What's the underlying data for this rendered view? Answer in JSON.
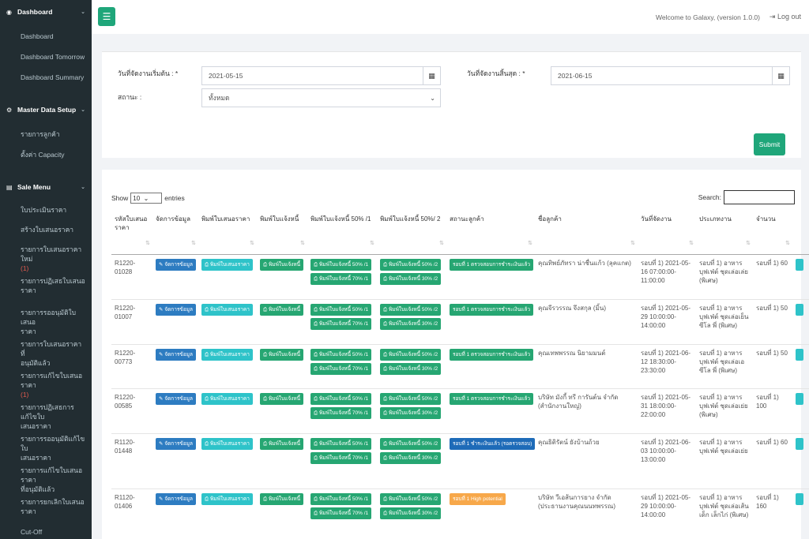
{
  "sidebar": {
    "sections": [
      {
        "title": "Dashboard",
        "icon": "gauge-icon",
        "items": [
          "Dashboard",
          "Dashboard Tomorrow",
          "Dashboard Summary"
        ]
      },
      {
        "title": "Master Data Setup",
        "icon": "gear-icon",
        "items": [
          "รายการลูกค้า",
          "ตั้งค่า Capacity"
        ]
      },
      {
        "title": "Sale Menu",
        "icon": "document-icon",
        "items": [
          "ใบประเมินราคา",
          "สร้างใบเสนอราคา",
          "รายการใบเสนอราคาใหม่",
          "(1)",
          "รายการปฏิเสธใบเสนอ",
          "ราคา",
          "รายการรออนุมัติใบเสนอ",
          "ราคา",
          "รายการใบเสนอราคาที่",
          "อนุมัติแล้ว",
          "รายการแก้ไขใบเสนอราคา",
          "(1)",
          "รายการปฏิเสธการแก้ไขใบ",
          "เสนอราคา",
          "รายการรออนุมัติแก้ไขใบ",
          "เสนอราคา",
          "รายการแก้ไขใบเสนอราคา",
          "ที่อนุมัติแล้ว",
          "รายการยกเลิกใบเสนอ",
          "ราคา",
          "Cut-Off"
        ]
      }
    ]
  },
  "header": {
    "welcome": "Welcome to Galaxy, (version 1.0.0)",
    "logout": "Log out"
  },
  "filter": {
    "start_label": "วันที่จัดงานเริ่มต้น : *",
    "start_value": "2021-05-15",
    "end_label": "วันที่จัดงานสิ้นสุด : *",
    "end_value": "2021-06-15",
    "status_label": "สถานะ :",
    "status_value": "ทั้งหมด",
    "submit": "Submit"
  },
  "table": {
    "show_label": "Show",
    "show_value": "10",
    "entries_label": "entries",
    "search_label": "Search:",
    "columns": [
      "รหัสใบเสนอราคา",
      "จัดการข้อมูล",
      "พิมพ์ใบเสนอราคา",
      "พิมพ์ใบแจ้งหนี้",
      "พิมพ์ใบแจ้งหนี้ 50% /1",
      "พิมพ์ใบแจ้งหนี้ 50%/ 2",
      "สถานะลูกค้า",
      "ชื่อลูกค้า",
      "วันที่จัดงาน",
      "ประเภทงาน",
      "จำนวน"
    ],
    "labels": {
      "manage": "จัดการข้อมูล",
      "print_quote": "พิมพ์ใบเสนอราคา",
      "print_invoice": "พิมพ์ใบแจ้งหนี้",
      "inv_50_1": "พิมพ์ใบแจ้งหนี้ 50% /1",
      "inv_70_1": "พิมพ์ใบแจ้งหนี้ 70% /1",
      "inv_50_2": "พิมพ์ใบแจ้งหนี้ 50% /2",
      "inv_30_2": "พิมพ์ใบแจ้งหนี้ 30% /2"
    },
    "rows": [
      {
        "code": "R1220-01028",
        "status": "รอบที่ 1 ตรวจสอบการชำระเงินแล้ว",
        "status_color": "#26a672",
        "customer": "คุณทิพย์ภัทรา น่าชื่นแก้ว (ลุคแกต)",
        "date": "รอบที่ 1) 2021-05-16 07:00:00-11:00:00",
        "type": "รอบที่ 1) อาหาร บุฟเฟ่ต์ ชุดเล่อเล่ย (พิเศษ)",
        "qty": "รอบที่ 1) 60"
      },
      {
        "code": "R1220-01007",
        "status": "รอบที่ 1 ตรวจสอบการชำระเงินแล้ว",
        "status_color": "#26a672",
        "customer": "คุณจีรวรรณ จึงสกุล (มิ้น)",
        "date": "รอบที่ 1) 2021-05-29 10:00:00-14:00:00",
        "type": "รอบที่ 1) อาหาร บุฟเฟ่ต์ ชุดเล่อเย็นซีโล พี่ (พิเศษ)",
        "qty": "รอบที่ 1) 50"
      },
      {
        "code": "R1220-00773",
        "status": "รอบที่ 1 ตรวจสอบการชำระเงินแล้ว",
        "status_color": "#26a672",
        "customer": "คุณเทพพรรณ นิยามมนต์",
        "date": "รอบที่ 1) 2021-06-12 18:30:00-23:30:00",
        "type": "รอบที่ 1) อาหาร บุฟเฟ่ต์ ชุดเล่อเอซีโล พี่ (พิเศษ)",
        "qty": "รอบที่ 1) 50"
      },
      {
        "code": "R1220-00585",
        "status": "รอบที่ 1 ตรวจสอบการชำระเงินแล้ว",
        "status_color": "#26a672",
        "customer": "บริษัท มังกี้ ทรี การันต์น จำกัด (สำนักงานใหญ่)",
        "date": "รอบที่ 1) 2021-05-31 18:00:00-22:00:00",
        "type": "รอบที่ 1) อาหาร บุฟเฟ่ต์ ชุดเล่อเย่ย (พิเศษ)",
        "qty": "รอบที่ 1) 100"
      },
      {
        "code": "R1120-01448",
        "status": "รอบที่ 1 ชำระเงินแล้ว (รอตรวจสอบ)",
        "status_color": "#1e6bb8",
        "customer": "คุณธิติรัตน์ ยังบ้านถ้วย",
        "date": "รอบที่ 1) 2021-06-03 10:00:00-13:00:00",
        "type": "รอบที่ 1) อาหาร บุฟเฟ่ต์ ชุดเล่อเย่ย",
        "qty": "รอบที่ 1) 60"
      },
      {
        "code": "R1120-01406",
        "status": "รอบที่ 1 High potential",
        "status_color": "#f7a84a",
        "customer": "บริษัท วีเอส้นการยาง จำกัด (ประธานงานคุณนนทพรรณ)",
        "date": "รอบที่ 1) 2021-05-29 10:00:00-14:00:00",
        "type": "รอบที่ 1) อาหาร บุฟเฟ่ต์ ชุดเล่อเส้นเด็ก เล็กไก่ (พิเศษ)",
        "qty": "รอบที่ 1) 160"
      }
    ]
  }
}
